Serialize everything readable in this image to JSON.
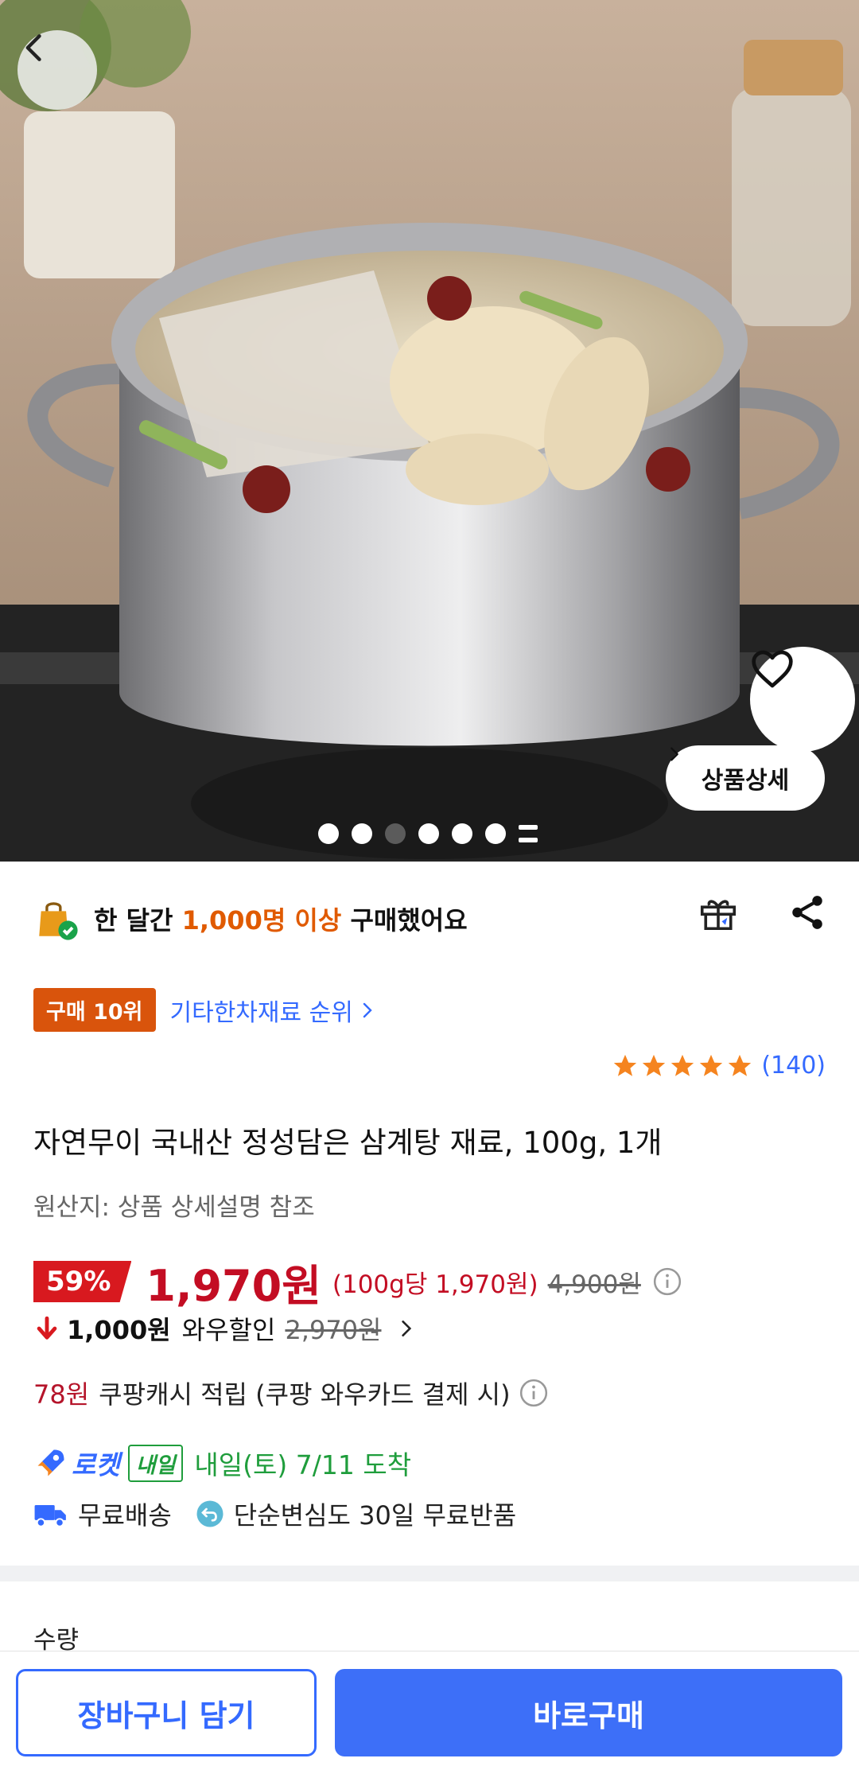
{
  "hero": {
    "detail_button": "상품상세",
    "dots_total": 6,
    "dots_active_index": 2
  },
  "purchase_info": {
    "prefix": "한 달간",
    "highlight": "1,000명 이상",
    "suffix": "구매했어요"
  },
  "ranking": {
    "badge": "구매 10위",
    "category_link": "기타한차재료 순위"
  },
  "rating": {
    "stars": 5,
    "review_count": "(140)"
  },
  "product": {
    "title": "자연무이 국내산 정성담은 삼계탕 재료, 100g, 1개",
    "origin": "원산지: 상품 상세설명 참조"
  },
  "price": {
    "discount": "59%",
    "final": "1,970원",
    "unit": "(100g당 1,970원)",
    "original": "4,900원"
  },
  "wow": {
    "amount": "1,000원",
    "label": "와우할인",
    "previous": "2,970원"
  },
  "cashback": {
    "amount": "78원",
    "text": "쿠팡캐시 적립 (쿠팡 와우카드 결제 시)"
  },
  "delivery": {
    "rocket_label": "로켓",
    "tomorrow_tag": "내일",
    "arrival": "내일(토) 7/11 도착",
    "free_shipping": "무료배송",
    "free_return": "단순변심도 30일 무료반품"
  },
  "quantity_label": "수량",
  "buttons": {
    "cart": "장바구니 담기",
    "buy": "바로구매"
  },
  "colors": {
    "accent_blue": "#346aff",
    "discount_red": "#d8191f",
    "rank_orange": "#d9540c",
    "delivery_green": "#1f9d3c"
  }
}
